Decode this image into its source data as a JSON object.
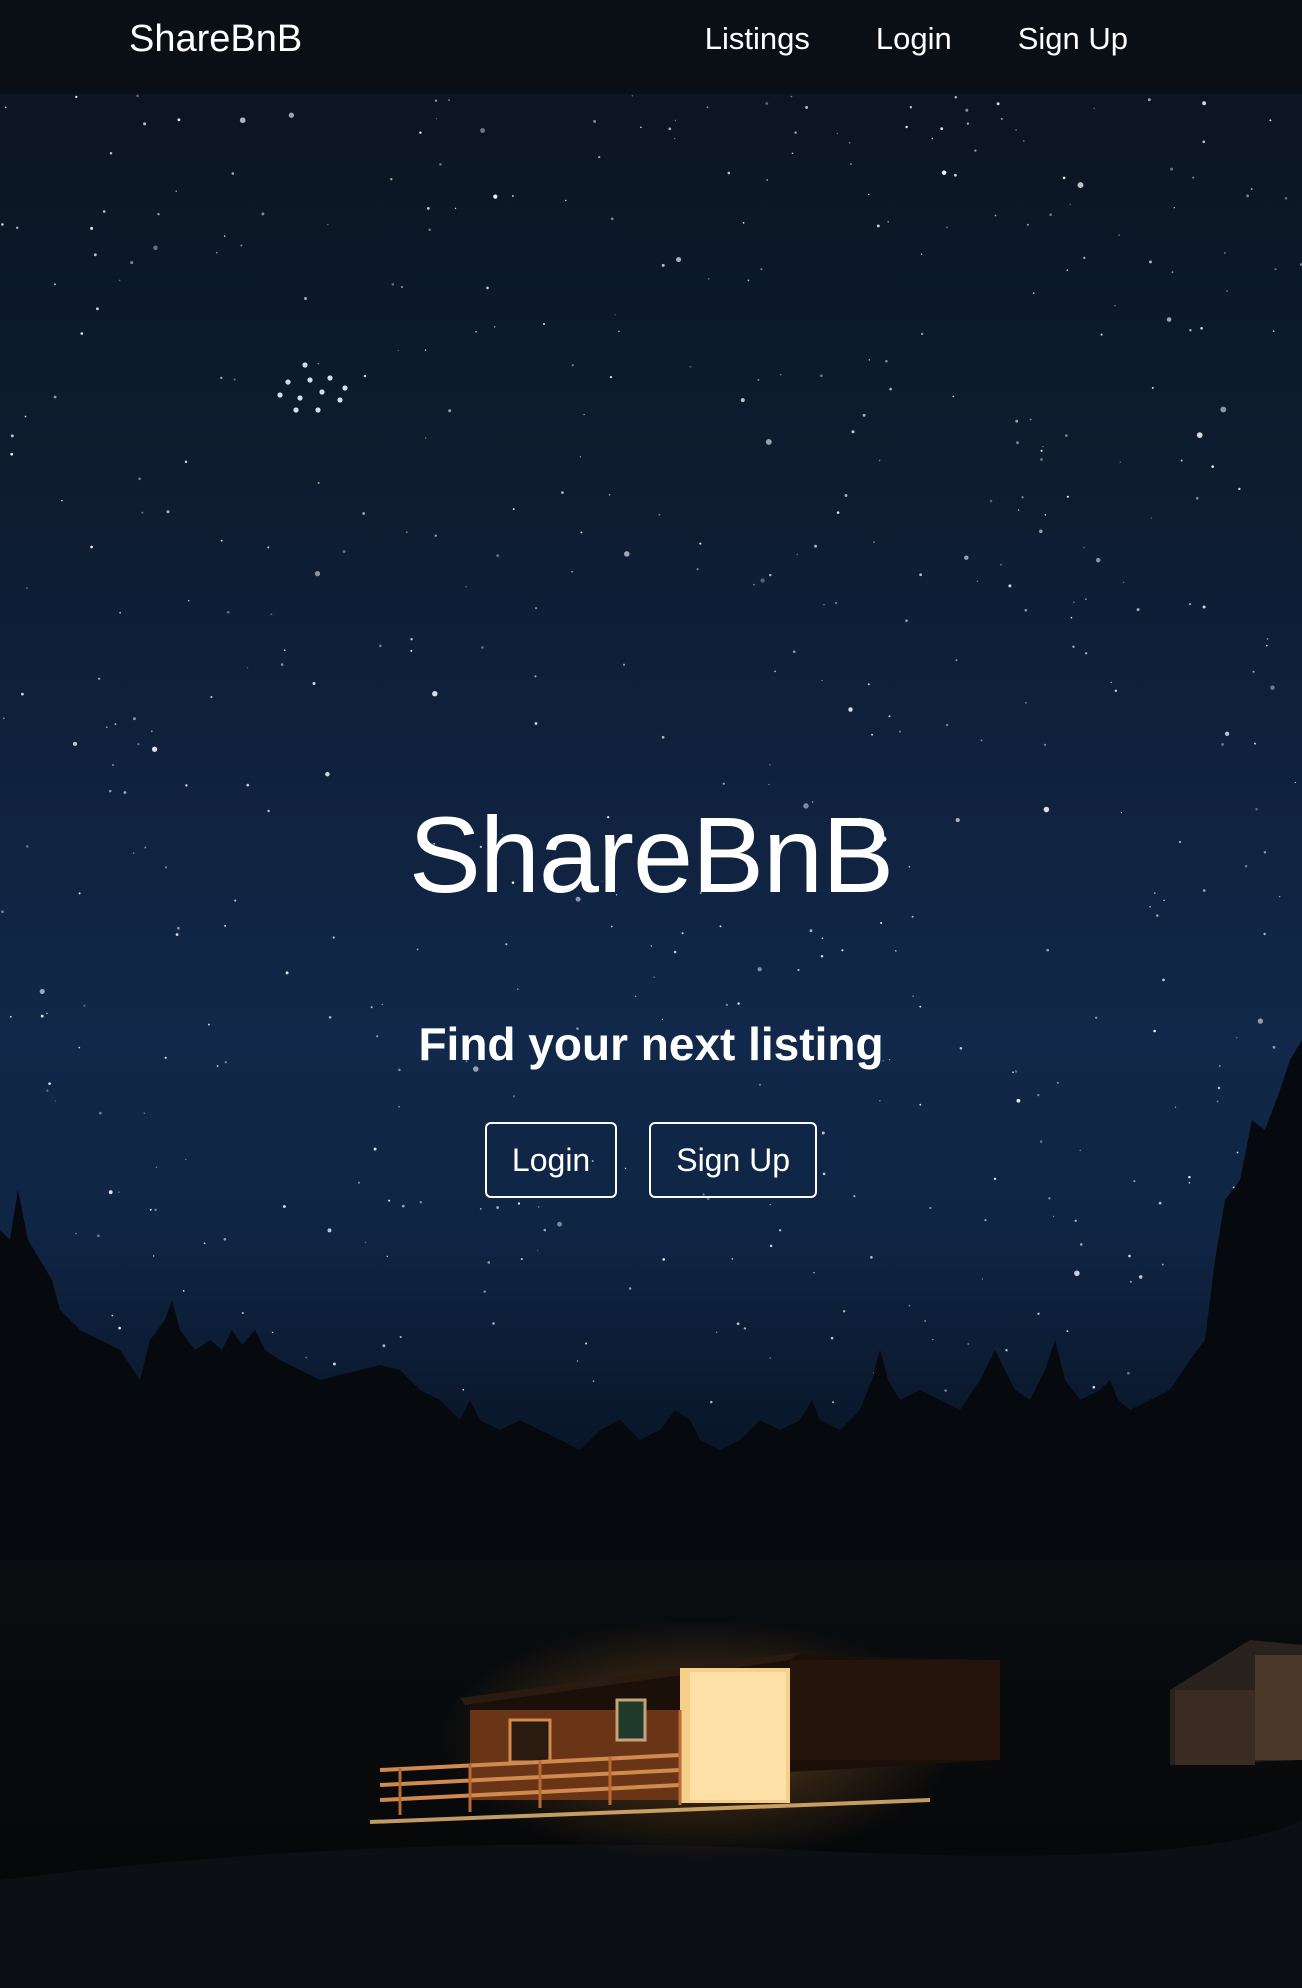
{
  "navbar": {
    "brand": "ShareBnB",
    "links": [
      {
        "label": "Listings"
      },
      {
        "label": "Login"
      },
      {
        "label": "Sign Up"
      }
    ]
  },
  "hero": {
    "title": "ShareBnB",
    "subtitle": "Find your next listing",
    "buttons": [
      {
        "label": "Login"
      },
      {
        "label": "Sign Up"
      }
    ]
  },
  "colors": {
    "navbar_bg": "#0a1016",
    "sky_top": "#0b1520",
    "sky_mid": "#10264a",
    "text": "#ffffff",
    "cabin_glow": "#f2a23a"
  }
}
